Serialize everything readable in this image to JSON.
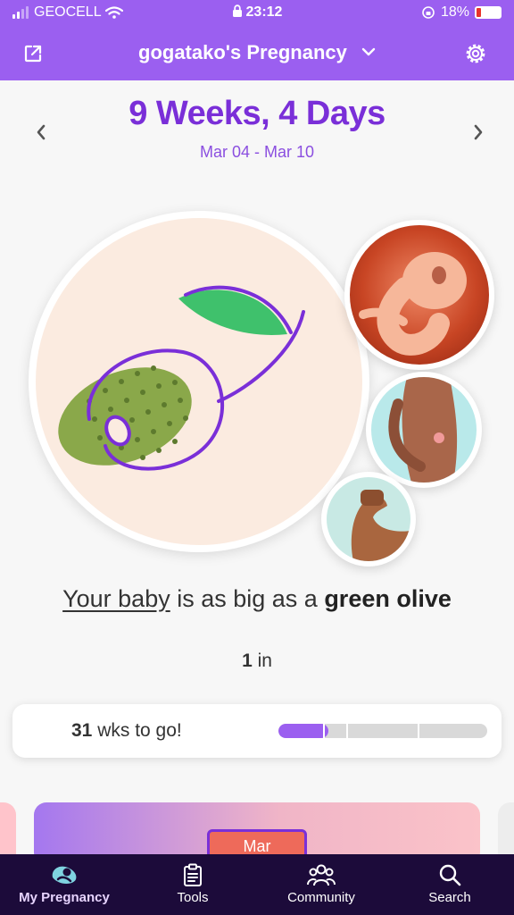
{
  "status_bar": {
    "carrier": "GEOCELL",
    "time": "23:12",
    "battery": "18%"
  },
  "header": {
    "title": "gogatako's Pregnancy"
  },
  "week": {
    "title": "9 Weeks, 4 Days",
    "dates": "Mar 04 - Mar 10"
  },
  "size": {
    "prefix_link": "Your baby",
    "middle": " is as big as a ",
    "fruit": "green olive"
  },
  "measure": {
    "value": "1",
    "unit": " in"
  },
  "progress": {
    "weeks": "31",
    "label": " wks to go!",
    "fraction": 0.24
  },
  "month_card": {
    "month": "Mar"
  },
  "nav": [
    {
      "label": "My Pregnancy",
      "icon": "baby-icon",
      "active": true
    },
    {
      "label": "Tools",
      "icon": "clipboard-icon",
      "active": false
    },
    {
      "label": "Community",
      "icon": "people-icon",
      "active": false
    },
    {
      "label": "Search",
      "icon": "search-icon",
      "active": false
    }
  ],
  "colors": {
    "accent": "#9b5ff0",
    "title": "#7a2fd8",
    "nav_bg": "#1c0b3a",
    "olive": "#8aa84a",
    "leaf": "#3fc16c"
  }
}
